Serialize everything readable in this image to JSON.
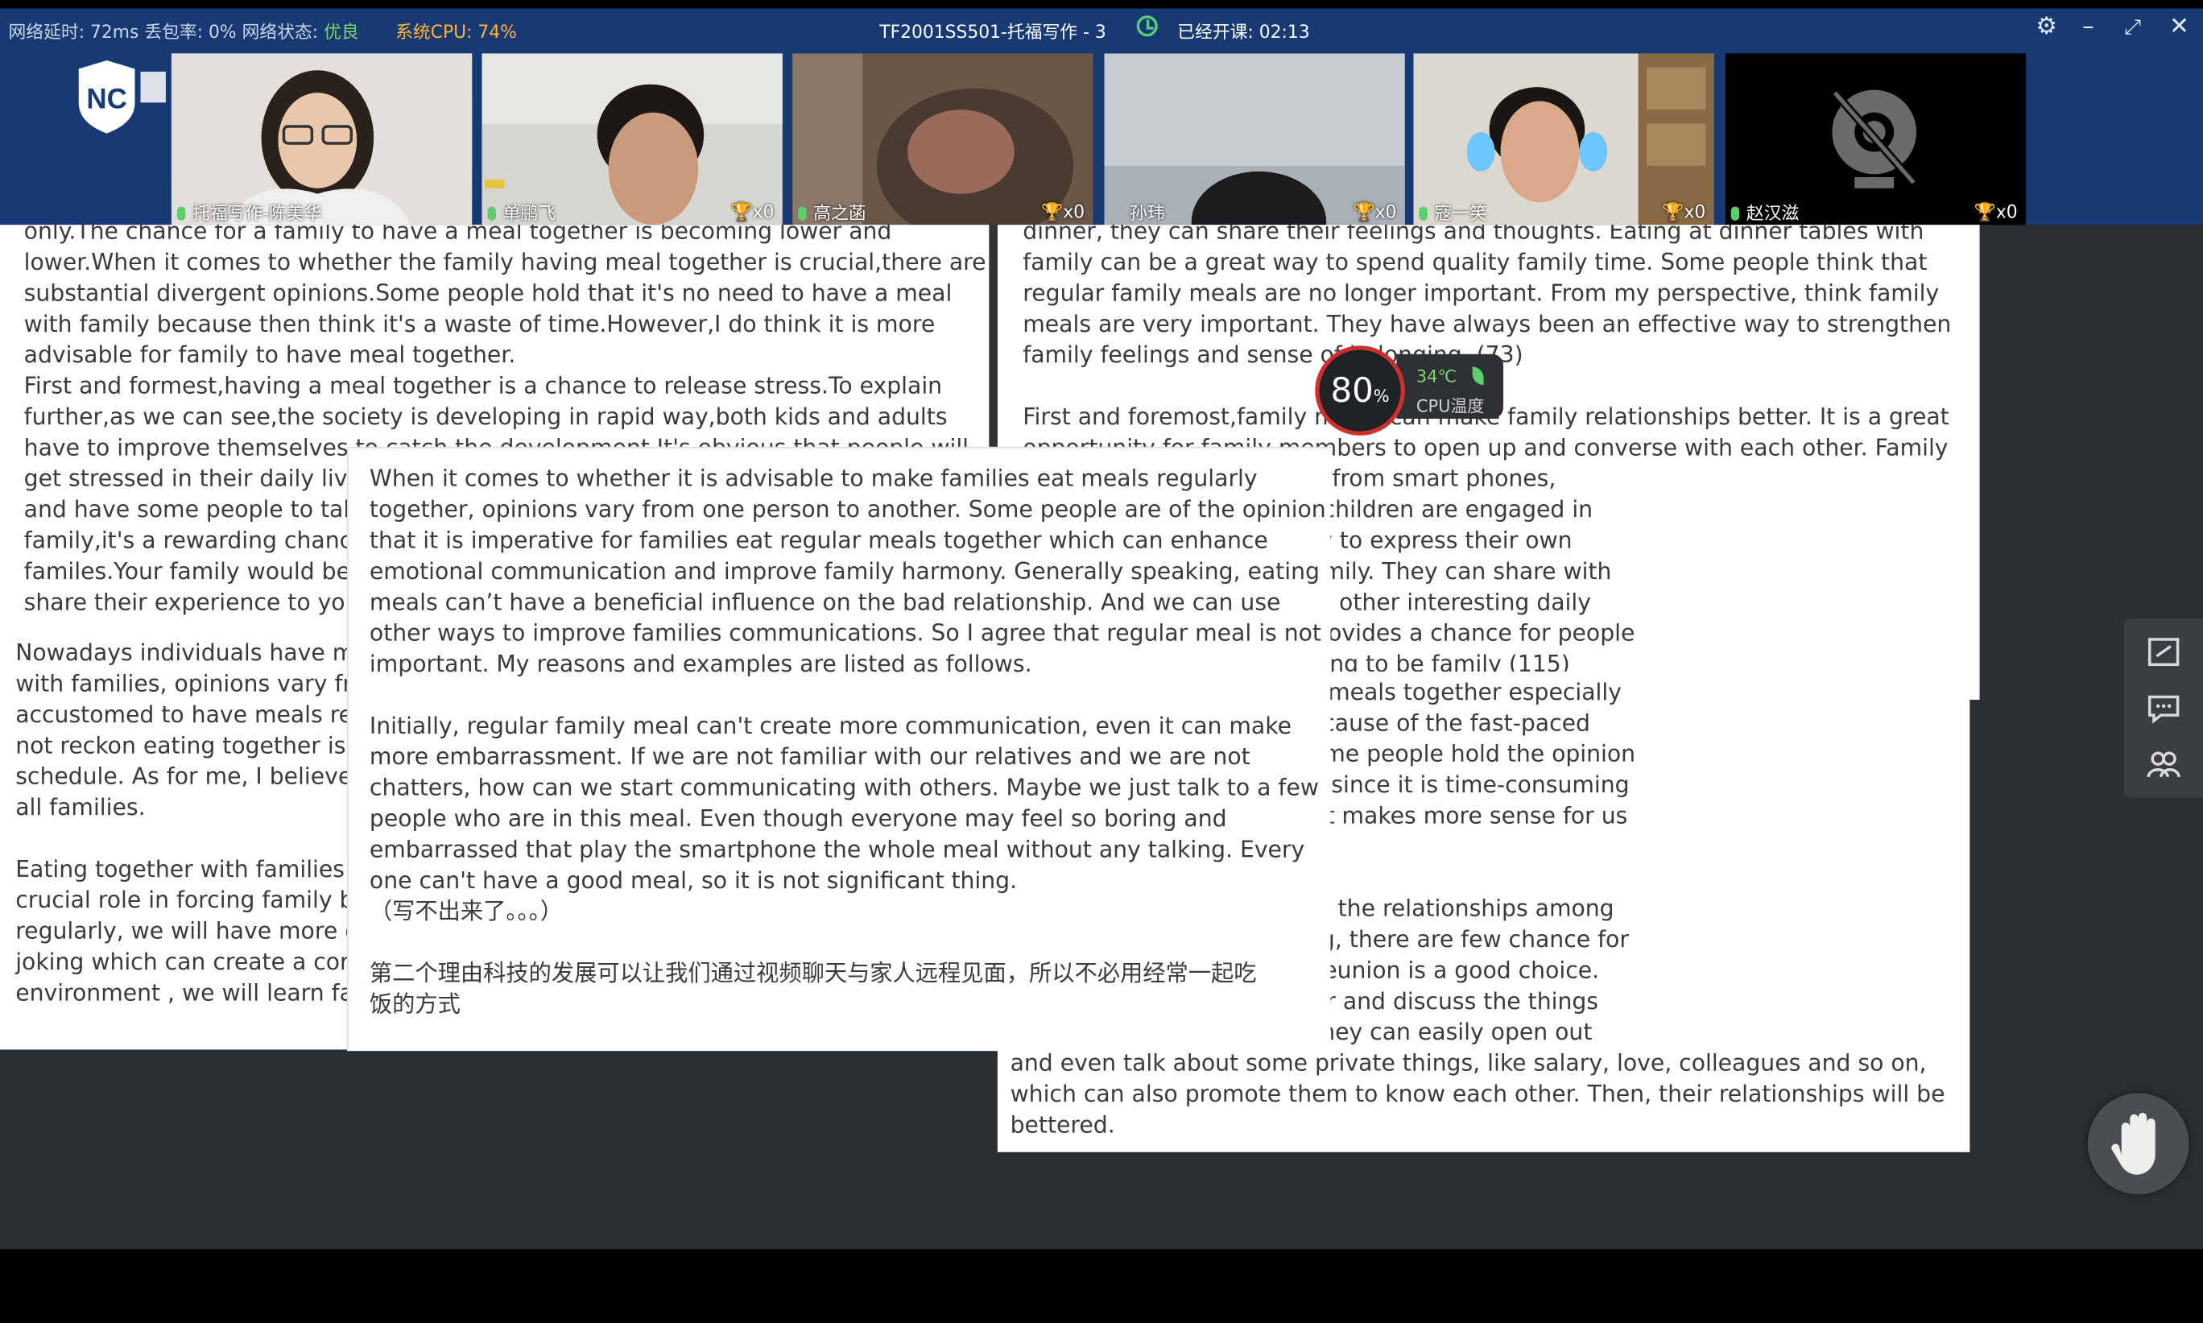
{
  "topbar": {
    "network_label": "网络延时: 72ms 丢包率: 0% 网络状态:",
    "network_status": "优良",
    "cpu_label": "系统CPU: 74%",
    "class_title": "TF2001SS501-托福写作 - 3",
    "elapsed": "已经开课: 02:13"
  },
  "participants": [
    {
      "name": "托福写作-陈美华",
      "trophies": ""
    },
    {
      "name": "单鹏飞",
      "trophies": "x0"
    },
    {
      "name": "高之菡",
      "trophies": "x0"
    },
    {
      "name": "孙玮",
      "trophies": "x0"
    },
    {
      "name": "寇一笑",
      "trophies": "x0"
    },
    {
      "name": "赵汉滋",
      "trophies": "x0"
    }
  ],
  "cpu_widget": {
    "percent": "80",
    "unit": "%",
    "temp": "34℃",
    "label": "CPU温度"
  },
  "essay_left_top": [
    "only.The chance for a family to have a meal together is becoming lower and",
    "lower.When it comes to whether the family having meal together is crucial,there are",
    "substantial divergent opinions.Some people hold that it's no need to have a meal",
    "with family because then think it's a waste of time.However,I do think it is more",
    "advisable for family to have meal together.",
    "First and formest,having a meal together is a chance to release stress.To explain",
    "further,as we can see,the society is developing in rapid way,both kids and adults",
    "have to improve themselves to catch the development.It's obvious that people will",
    "get stressed in their daily live",
    "and have some people to tal",
    "family,it's a rewarding chanc",
    "familes.Your family would be",
    "share their experience to you"
  ],
  "essay_left_bottom": [
    "Nowadays individuals have m",
    "with families, opinions vary fr",
    "accustomed to have meals re",
    "not reckon eating together is",
    "schedule. As for me, I believe",
    "all families.",
    "",
    "Eating together with families",
    "crucial role in forcing family b",
    "regularly, we will have more c",
    "joking which can create a cor",
    "environment , we will learn fa"
  ],
  "essay_right_top": [
    "dinner, they can share their feelings and thoughts. Eating at dinner tables with",
    "family can be a great way to spend quality family time. Some people think that",
    "regular family meals are no longer important.  From my perspective, think family",
    "meals are very important. They have always been an effective way to strengthen",
    "family feelings and sense of belonging. (73)",
    "",
    "First and foremost,family meals can make family relationships better. It is a great",
    "opportunity for family members to open up and converse with each other. Family",
    "sation without distractions from smart phones,",
    "nobile devices.Plus, when children are engaged in",
    "ught how to listen and how to express their own",
    "r voice heard within the family. They can share with",
    "nat they learn in class, and other interesting daily",
    "ner together as a family provides a chance for people",
    "build up a sense of belonging to be family (115)"
  ],
  "essay_right_bottom": [
    "ich means that families eat meals together especially",
    "as become less and less because of the fast-paced",
    "rly with families pivotal? Some people hold the opinion",
    "es regularly isn't significant since it is time-consuming",
    "ers. However, to my mind, it makes more sense for us",
    "rly.",
    "",
    "nilies regularly can enhance the relationships among",
    "pularization of online talking, there are few chance for",
    "rt talk. Fortunately, family reunion is a good choice.",
    "lly members will sit together and discuss the things",
    "y online. Thanks to beers, they can easily open out",
    "and even talk about some private things, like salary, love, colleagues and so on,",
    "which can also promote them to know each other. Then, their relationships will be",
    "bettered."
  ],
  "essay_center": [
    "When it comes to whether it is advisable to make families eat meals regularly",
    "together, opinions vary from one person to another. Some people are of the opinion",
    "that it is imperative for families eat regular meals together which can enhance",
    "emotional communication and improve family harmony. Generally speaking, eating",
    "meals can’t have a beneficial influence on the bad relationship. And we can use",
    "other ways to improve families communications. So I agree that regular meal is not",
    "important. My reasons and examples are listed as follows.",
    "",
    "Initially, regular family meal can't create more communication, even it can make",
    "more embarrassment. If we are not familiar with our relatives and we are not",
    "chatters, how can we start communicating with others. Maybe we just talk to a few",
    "people who are in this meal. Even though everyone may feel so boring and",
    "embarrassed that play the smartphone the whole meal without any talking. Every",
    "one can't have a good meal, so it is not significant thing.",
    "（写不出来了。。。）",
    "",
    "第二个理由科技的发展可以让我们通过视频聊天与家人远程见面，所以不必用经常一起吃",
    "饭的方式"
  ]
}
